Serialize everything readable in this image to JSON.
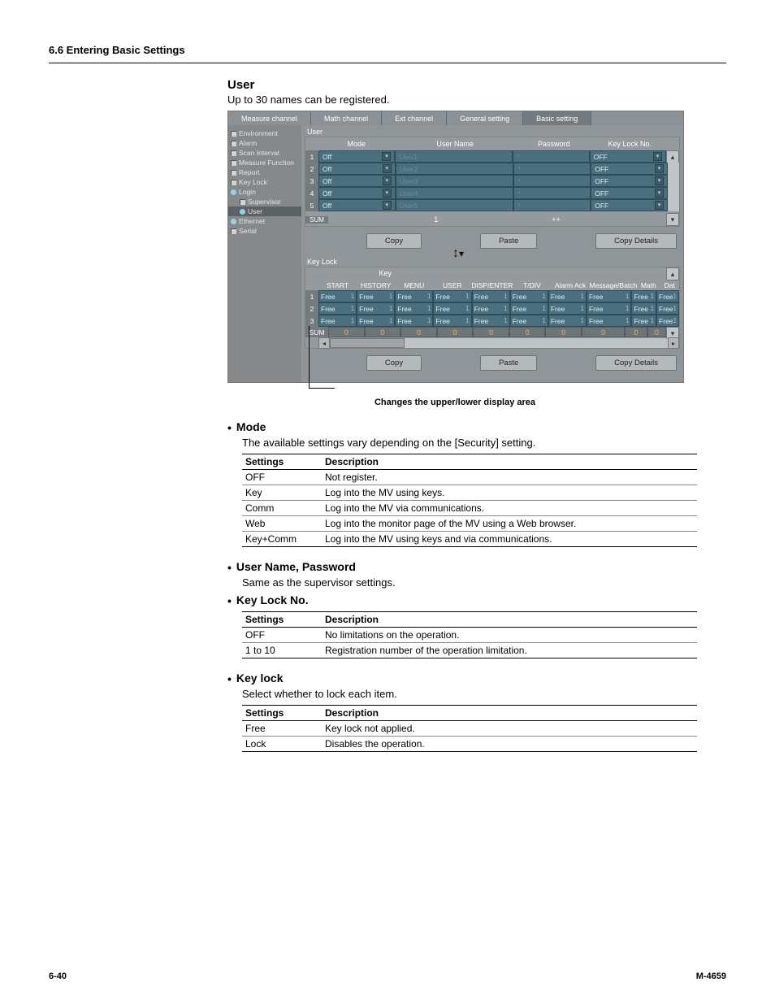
{
  "section_header": "6.6 Entering Basic Settings",
  "user": {
    "heading": "User",
    "desc": "Up to 30 names can be registered."
  },
  "figure": {
    "tabs": [
      "Measure channel",
      "Math channel",
      "Ext channel",
      "General setting",
      "Basic setting"
    ],
    "tree": [
      {
        "label": "Environment",
        "type": "sq"
      },
      {
        "label": "Alarm",
        "type": "sq"
      },
      {
        "label": "Scan Interval",
        "type": "sq"
      },
      {
        "label": "Measure Function",
        "type": "sq"
      },
      {
        "label": "Report",
        "type": "sq"
      },
      {
        "label": "Key Lock",
        "type": "sq"
      },
      {
        "label": "Login",
        "type": "circ"
      },
      {
        "label": "Supervisor",
        "type": "sq",
        "sub": true
      },
      {
        "label": "User",
        "type": "circ",
        "sub": true,
        "sel": true
      },
      {
        "label": "Ethernet",
        "type": "circ"
      },
      {
        "label": "Serial",
        "type": "sq"
      }
    ],
    "user_panel": {
      "title": "User",
      "cols": [
        "",
        "Mode",
        "User Name",
        "Password",
        "Key Lock No."
      ],
      "rows": [
        {
          "n": "1",
          "mode": "Off",
          "name": "User1",
          "pass": "*",
          "kl": "OFF"
        },
        {
          "n": "2",
          "mode": "Off",
          "name": "User2",
          "pass": "*",
          "kl": "OFF"
        },
        {
          "n": "3",
          "mode": "Off",
          "name": "User3",
          "pass": "*",
          "kl": "OFF"
        },
        {
          "n": "4",
          "mode": "Off",
          "name": "User4",
          "pass": "*",
          "kl": "OFF"
        },
        {
          "n": "5",
          "mode": "Off",
          "name": "User5",
          "pass": "*",
          "kl": "OFF"
        }
      ],
      "sum_label": "SUM",
      "pager_left": "1",
      "pager_right": "++",
      "buttons": {
        "copy": "Copy",
        "paste": "Paste",
        "details": "Copy Details"
      }
    },
    "keylock_panel": {
      "title": "Key Lock",
      "group1": "Key",
      "group2": "",
      "cols": [
        "START",
        "HISTORY",
        "MENU",
        "USER",
        "DISP/ENTER",
        "T/DIV",
        "Alarm Ack",
        "Message/Batch",
        "Math",
        "Dat"
      ],
      "rows": [
        {
          "n": "1"
        },
        {
          "n": "2"
        },
        {
          "n": "3"
        }
      ],
      "cell_text": "Free",
      "cell_val": "1",
      "sum_label": "SUM",
      "sum_val": "0",
      "buttons": {
        "copy": "Copy",
        "paste": "Paste",
        "details": "Copy Details"
      }
    },
    "caption": "Changes the upper/lower display area"
  },
  "mode": {
    "title": "Mode",
    "desc": "The available settings vary depending on the [Security] setting.",
    "th": {
      "c1": "Settings",
      "c2": "Description"
    },
    "rows": [
      {
        "c1": "OFF",
        "c2": "Not register."
      },
      {
        "c1": "Key",
        "c2": "Log into the MV using keys."
      },
      {
        "c1": "Comm",
        "c2": "Log into the MV via communications."
      },
      {
        "c1": "Web",
        "c2": "Log into the monitor page of the MV using a Web browser."
      },
      {
        "c1": "Key+Comm",
        "c2": "Log into the MV using keys and via communications."
      }
    ]
  },
  "unp": {
    "title": "User Name, Password",
    "desc": "Same as the supervisor settings."
  },
  "kln": {
    "title": "Key Lock No.",
    "th": {
      "c1": "Settings",
      "c2": "Description"
    },
    "rows": [
      {
        "c1": "OFF",
        "c2": "No limitations on the operation."
      },
      {
        "c1": "1 to 10",
        "c2": "Registration number of the operation limitation."
      }
    ]
  },
  "kl": {
    "title": "Key lock",
    "desc": "Select whether to lock each item.",
    "th": {
      "c1": "Settings",
      "c2": "Description"
    },
    "rows": [
      {
        "c1": "Free",
        "c2": "Key lock not applied."
      },
      {
        "c1": "Lock",
        "c2": "Disables the operation."
      }
    ]
  },
  "footer": {
    "left": "6-40",
    "right": "M-4659"
  }
}
